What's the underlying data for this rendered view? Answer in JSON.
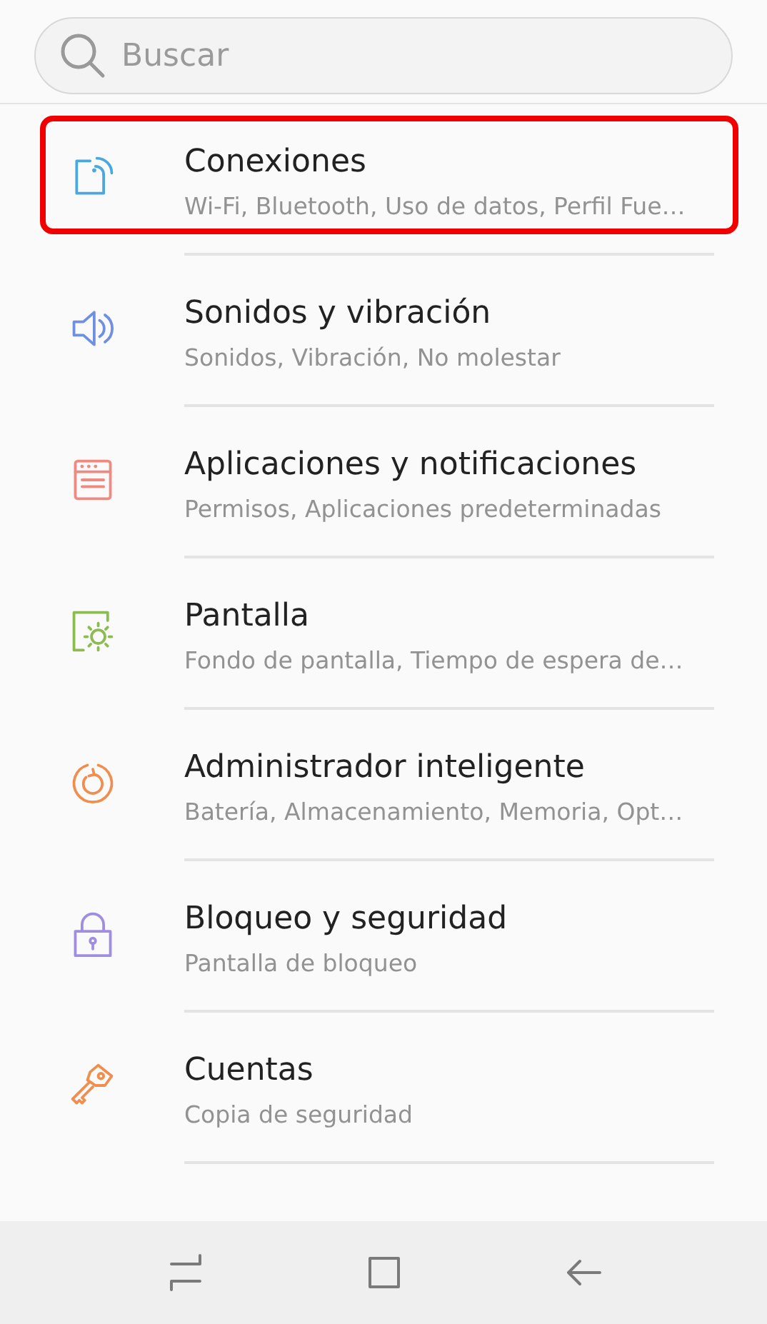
{
  "search": {
    "placeholder": "Buscar"
  },
  "items": [
    {
      "kind": "connections",
      "title": "Conexiones",
      "subtitle": "Wi-Fi, Bluetooth, Uso de datos, Perfil Fue…",
      "color": "#4aa8de",
      "highlighted": true
    },
    {
      "kind": "sound",
      "title": "Sonidos y vibración",
      "subtitle": "Sonidos, Vibración, No molestar",
      "color": "#6f8fe0",
      "highlighted": false
    },
    {
      "kind": "apps",
      "title": "Aplicaciones y notificaciones",
      "subtitle": "Permisos, Aplicaciones predeterminadas",
      "color": "#ee8a80",
      "highlighted": false
    },
    {
      "kind": "display",
      "title": "Pantalla",
      "subtitle": "Fondo de pantalla, Tiempo de espera de…",
      "color": "#8cbb4f",
      "highlighted": false
    },
    {
      "kind": "maintenance",
      "title": "Administrador inteligente",
      "subtitle": "Batería, Almacenamiento, Memoria, Opt…",
      "color": "#ef8e4f",
      "highlighted": false
    },
    {
      "kind": "lock",
      "title": "Bloqueo y seguridad",
      "subtitle": "Pantalla de bloqueo",
      "color": "#a08de0",
      "highlighted": false
    },
    {
      "kind": "key",
      "title": "Cuentas",
      "subtitle": "Copia de seguridad",
      "color": "#ef8e4f",
      "highlighted": false
    }
  ]
}
